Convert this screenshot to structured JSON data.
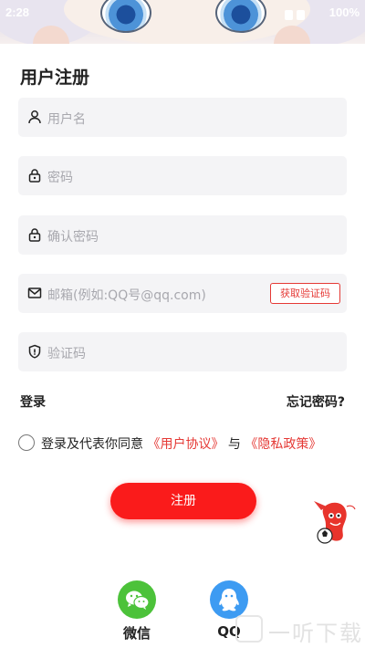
{
  "status_bar": {
    "time": "2:28",
    "battery": "100%"
  },
  "page": {
    "title": "用户注册"
  },
  "fields": {
    "username_placeholder": "用户名",
    "password_placeholder": "密码",
    "confirm_password_placeholder": "确认密码",
    "email_placeholder": "邮箱(例如:QQ号@qq.com)",
    "code_placeholder": "验证码",
    "get_code_label": "获取验证码"
  },
  "links": {
    "login": "登录",
    "forgot": "忘记密码?"
  },
  "agreement": {
    "prefix": "登录及代表你同意",
    "user_agreement": "《用户协议》",
    "and": "与",
    "privacy_policy": "《隐私政策》",
    "checked": false
  },
  "register_button": "注册",
  "social": {
    "wechat": "微信",
    "qq": "QQ"
  },
  "watermark": "一听下载",
  "colors": {
    "accent": "#fa1b1b",
    "link_red": "#e53935",
    "wechat": "#4cc23a",
    "qq": "#3d9bf2"
  },
  "icons": [
    "user-icon",
    "lock-icon",
    "lock-icon",
    "mail-icon",
    "shield-icon",
    "wechat-icon",
    "qq-icon"
  ]
}
